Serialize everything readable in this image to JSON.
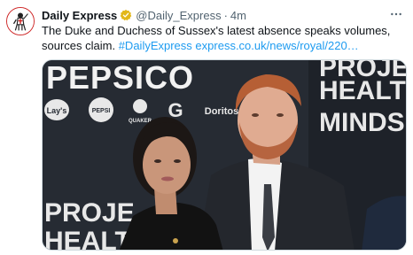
{
  "tweet": {
    "author": {
      "display_name": "Daily Express",
      "handle": "@Daily_Express",
      "verified": true,
      "avatar_icon": "daily-express-crusader-logo"
    },
    "separator": "·",
    "time": "4m",
    "text_parts": [
      {
        "type": "text",
        "value": "The Duke and Duchess of Sussex's latest absence speaks volumes, sources claim. "
      },
      {
        "type": "hashtag",
        "value": "#DailyExpress"
      },
      {
        "type": "text",
        "value": " "
      },
      {
        "type": "link",
        "value": "express.co.uk/news/royal/220…"
      }
    ],
    "media": {
      "alt_icon": "photo-image",
      "backdrop_text": {
        "brand": "PEPSICO",
        "right_lines": [
          "PROJE",
          "HEALT",
          "MINDS"
        ],
        "bottom_lines": [
          "PROJE",
          "HEALT"
        ],
        "logos": [
          "Lay's",
          "PEPSI",
          "QUAKER",
          "G",
          "Doritos"
        ]
      }
    },
    "colors": {
      "link": "#1d9bf0",
      "verified_badge": "#e2b719",
      "secondary_text": "#536471"
    }
  }
}
